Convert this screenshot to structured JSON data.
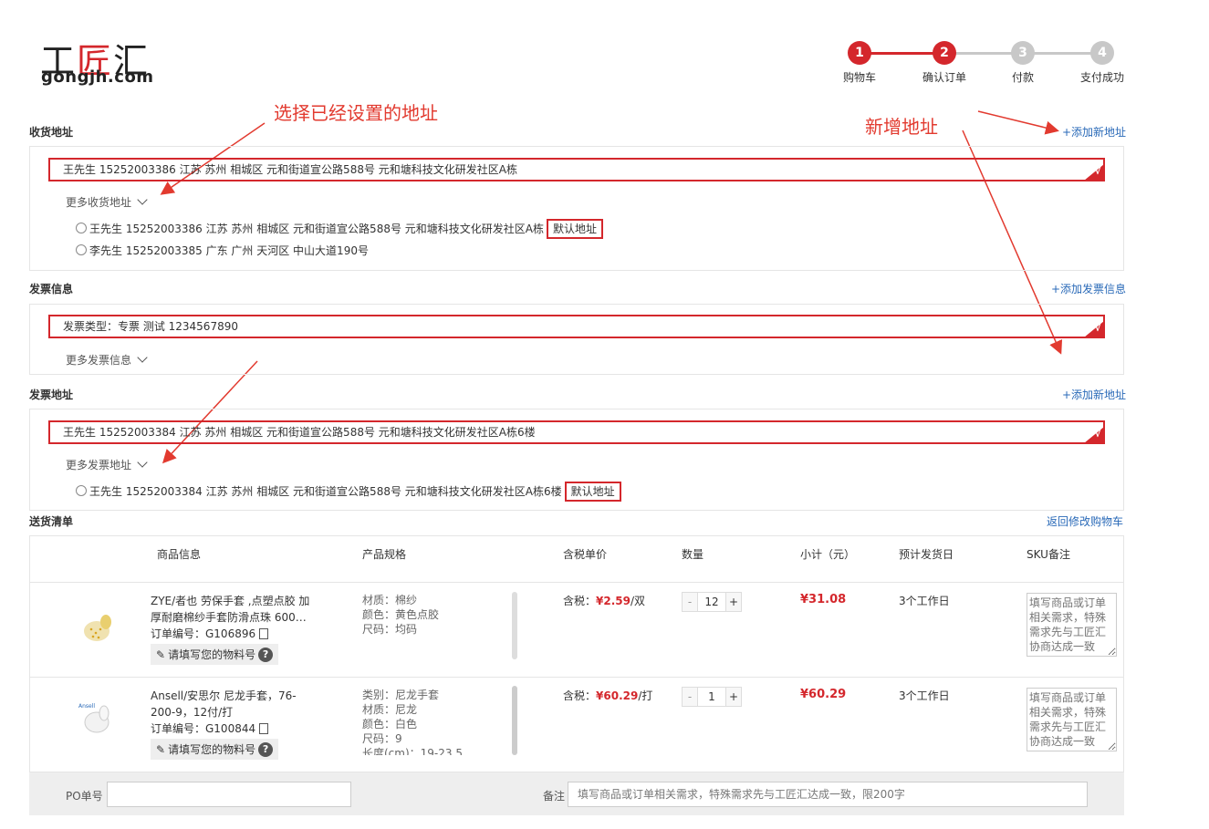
{
  "logo": {
    "cn_left": "工",
    "cn_mid": "匠",
    "cn_right": "汇",
    "en": "gongjh.com"
  },
  "steps": [
    {
      "num": "1",
      "label": "购物车",
      "color": "#d4272c"
    },
    {
      "num": "2",
      "label": "确认订单",
      "color": "#d4272c"
    },
    {
      "num": "3",
      "label": "付款",
      "color": "#c8c8c8"
    },
    {
      "num": "4",
      "label": "支付成功",
      "color": "#c8c8c8"
    }
  ],
  "annotations": {
    "select_address": "选择已经设置的地址",
    "new_address": "新增地址"
  },
  "shipping": {
    "title": "收货地址",
    "add_link": "+添加新地址",
    "selected": "王先生  15252003386  江苏  苏州  相城区  元和街道宣公路588号  元和塘科技文化研发社区A栋",
    "more": "更多收货地址",
    "options": [
      {
        "text": "王先生 15252003386 江苏 苏州 相城区 元和街道宣公路588号 元和塘科技文化研发社区A栋",
        "tag": "默认地址"
      },
      {
        "text": "李先生 15252003385 广东 广州 天河区 中山大道190号",
        "tag": ""
      }
    ]
  },
  "invoice": {
    "title": "发票信息",
    "add_link": "+添加发票信息",
    "selected": "发票类型：专票  测试  1234567890",
    "more": "更多发票信息"
  },
  "invoice_address": {
    "title": "发票地址",
    "add_link": "+添加新地址",
    "selected": "王先生  15252003384  江苏  苏州  相城区  元和街道宣公路588号  元和塘科技文化研发社区A栋6楼",
    "more": "更多发票地址",
    "options": [
      {
        "text": "王先生 15252003384 江苏 苏州 相城区 元和街道宣公路588号 元和塘科技文化研发社区A栋6楼",
        "tag": "默认地址"
      }
    ]
  },
  "delivery": {
    "title": "送货清单",
    "back_link": "返回修改购物车",
    "columns": [
      "商品信息",
      "产品规格",
      "含税单价",
      "数量",
      "小计（元）",
      "预计发货日",
      "SKU备注"
    ],
    "items": [
      {
        "name_line1": "ZYE/者也 劳保手套 ,点塑点胶 加",
        "name_line2": "厚耐磨棉纱手套防滑点珠 600…",
        "order_no": "订单编号：G106896",
        "material_btn": "请填写您的物料号",
        "specs": [
          "材质：棉纱",
          "颜色：黄色点胶",
          "尺码：均码"
        ],
        "price_prefix": "含税：",
        "price": "¥2.59",
        "unit": "/双",
        "qty": "12",
        "subtotal": "¥31.08",
        "ship_day": "3个工作日",
        "note_placeholder": "填写商品或订单相关需求，特殊需求先与工匠汇协商达成一致"
      },
      {
        "name_line1": "Ansell/安思尔 尼龙手套，76-",
        "name_line2": "200-9，12付/打",
        "order_no": "订单编号：G100844",
        "material_btn": "请填写您的物料号",
        "specs": [
          "类别：尼龙手套",
          "材质：尼龙",
          "颜色：白色",
          "尺码：9",
          "长度(cm)：19-23.5"
        ],
        "price_prefix": "含税：",
        "price": "¥60.29",
        "unit": "/打",
        "qty": "1",
        "subtotal": "¥60.29",
        "ship_day": "3个工作日",
        "note_placeholder": "填写商品或订单相关需求，特殊需求先与工匠汇协商达成一致"
      }
    ],
    "qty_minus": "-",
    "qty_plus": "+"
  },
  "footer": {
    "po_label": "PO单号",
    "po_value": "",
    "remark_label": "备注",
    "remark_placeholder": "填写商品或订单相关需求，特殊需求先与工匠汇达成一致，限200字"
  }
}
